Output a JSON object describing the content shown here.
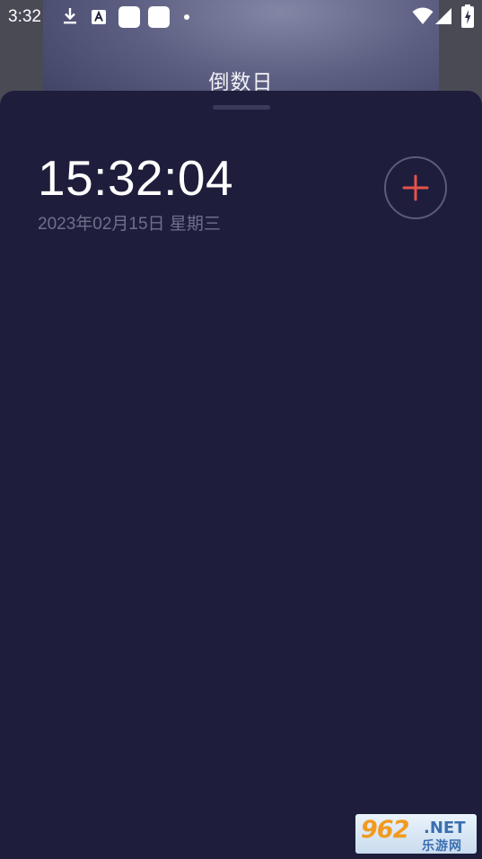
{
  "status_bar": {
    "time": "3:32",
    "icons": [
      "download-icon",
      "translate-a-icon",
      "app-notification-icon",
      "app-notification-icon",
      "dot-icon",
      "wifi-icon",
      "cellular-signal-icon",
      "battery-charging-icon"
    ]
  },
  "background_app": {
    "title": "倒数日"
  },
  "sheet": {
    "clock_time": "15:32:04",
    "date_text": "2023年02月15日 星期三",
    "add_button_icon": "plus-icon"
  },
  "watermark": {
    "number": "962",
    "suffix": ".NET",
    "site_name": "乐游网"
  },
  "colors": {
    "sheet_background": "#1e1e3c",
    "accent_plus": "#e5534b",
    "date_text": "#6f7089"
  }
}
